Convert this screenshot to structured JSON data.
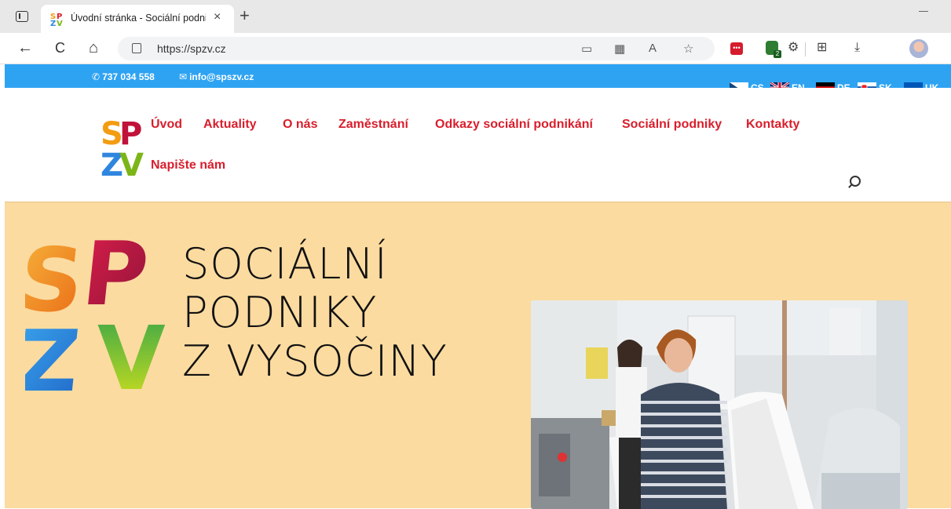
{
  "browser": {
    "tab_title": "Úvodní stránka - Sociální podnik",
    "tab_close": "×",
    "new_tab": "+",
    "back": "←",
    "reload": "C",
    "home": "⌂",
    "url": "https://spzv.cz",
    "extension_badge": "2",
    "extension_red_label": "•••"
  },
  "topbar": {
    "phone": "737 034 558",
    "email": "info@spszv.cz",
    "languages": [
      "CS",
      "EN",
      "DE",
      "SK",
      "UK"
    ]
  },
  "nav": {
    "items": [
      "Úvod",
      "Aktuality",
      "O nás",
      "Zaměstnání",
      "Odkazy sociální podnikání",
      "Sociální podniky",
      "Kontakty",
      "Napište nám"
    ]
  },
  "logo": {
    "letters": [
      "S",
      "P",
      "Z",
      "V"
    ]
  },
  "hero": {
    "title_lines": [
      "SOCIÁLNÍ",
      "PODNIKY",
      "Z VYSOČINY"
    ]
  },
  "colors": {
    "topbar": "#2ea3f2",
    "menu": "#d81e2c",
    "hero_bg": "#fbdba0"
  }
}
